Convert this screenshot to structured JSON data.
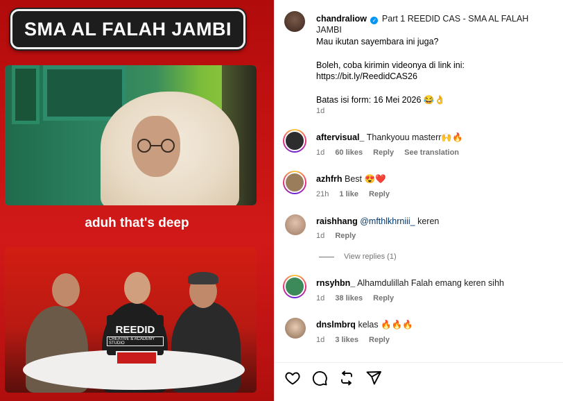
{
  "media": {
    "title_banner": "SMA AL FALAH JAMBI",
    "caption": "aduh that's deep",
    "laptop_text": "REEDID",
    "laptop_sub": "CREATIVE & ACADEMY STUDIO"
  },
  "post": {
    "username": "chandraliow",
    "title": "Part 1 REEDID CAS - SMA AL FALAH JAMBI",
    "lines": [
      "Mau ikutan sayembara ini juga?",
      "",
      "Boleh, coba kirimin videonya di link ini:",
      "https://bit.ly/ReedidCAS26",
      "",
      "Batas isi form: 16 Mei 2026 😂👌"
    ],
    "time": "1d"
  },
  "comments": [
    {
      "username": "aftervisual_",
      "text": "Thankyouu masterr🙌🔥",
      "time": "1d",
      "likes": "60 likes",
      "reply": "Reply",
      "translate": "See translation",
      "avatar_color": "#2d2d2d"
    },
    {
      "username": "azhfrh",
      "text": "Best 😍❤️",
      "time": "21h",
      "likes": "1 like",
      "reply": "Reply",
      "avatar_color": "#9a7d5a"
    },
    {
      "username": "raishhang",
      "mention": "@mfthlkhrniii_",
      "text": "keren",
      "time": "1d",
      "reply": "Reply",
      "avatar_color": "#c9a08a"
    },
    {
      "username": "rnsyhbn_",
      "text": "Alhamdulillah Falah emang keren sihh",
      "time": "1d",
      "likes": "38 likes",
      "reply": "Reply",
      "avatar_color": "#3c8a5a"
    },
    {
      "username": "dnslmbrq",
      "text": "kelas 🔥🔥🔥",
      "time": "1d",
      "likes": "3 likes",
      "reply": "Reply",
      "avatar_color": "#8a6a50"
    }
  ],
  "view_replies": "View replies (1)",
  "colors": {
    "accent": "#0095f6",
    "muted": "#737373",
    "media_red": "#c81414"
  }
}
